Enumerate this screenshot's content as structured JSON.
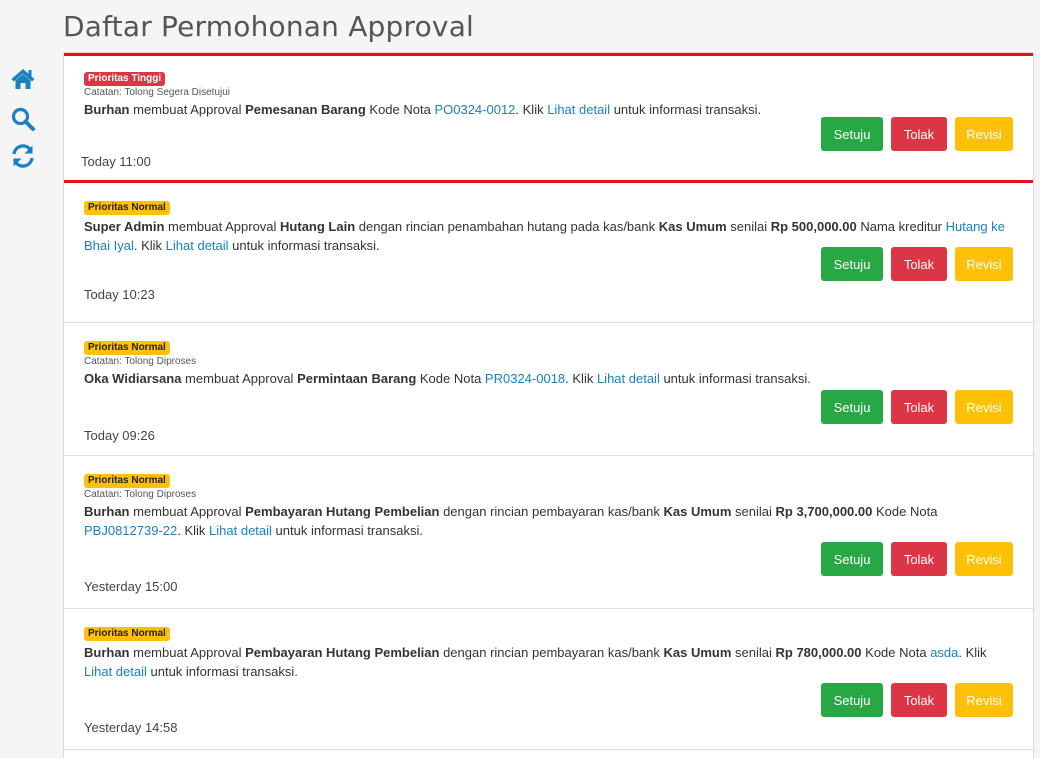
{
  "page": {
    "title": "Daftar Permohonan Approval"
  },
  "sidebar": {
    "icons": [
      "home-icon",
      "search-icon",
      "refresh-icon"
    ]
  },
  "colors": {
    "icon_blue": "#1a80c2",
    "setuju_green": "#28a745",
    "tolak_red": "#dc3545",
    "revisi_yellow": "#ffc107",
    "highlight_border": "#e8101c"
  },
  "buttons": {
    "approve": "Setuju",
    "reject": "Tolak",
    "revise": "Revisi"
  },
  "items": [
    {
      "priority": "Prioritas Tinggi",
      "priority_level": "high",
      "note": "Catatan: Tolong Segera Disetujui",
      "time": "Today 11:00",
      "selected": true,
      "message": [
        {
          "t": "b",
          "v": "Burhan"
        },
        {
          "t": "s",
          "v": " membuat Approval "
        },
        {
          "t": "b",
          "v": "Pemesanan Barang"
        },
        {
          "t": "s",
          "v": " Kode Nota "
        },
        {
          "t": "l",
          "v": "PO0324-0012"
        },
        {
          "t": "s",
          "v": ". Klik "
        },
        {
          "t": "l",
          "v": "Lihat detail"
        },
        {
          "t": "s",
          "v": " untuk informasi transaksi."
        }
      ]
    },
    {
      "priority": "Prioritas Normal",
      "priority_level": "normal",
      "note": "",
      "time": "Today 10:23",
      "selected": false,
      "message": [
        {
          "t": "b",
          "v": "Super Admin"
        },
        {
          "t": "s",
          "v": " membuat Approval "
        },
        {
          "t": "b",
          "v": "Hutang Lain"
        },
        {
          "t": "s",
          "v": " dengan rincian penambahan hutang pada kas/bank "
        },
        {
          "t": "b",
          "v": "Kas Umum"
        },
        {
          "t": "s",
          "v": " senilai "
        },
        {
          "t": "b",
          "v": "Rp 500,000.00"
        },
        {
          "t": "s",
          "v": " Nama kreditur "
        },
        {
          "t": "l",
          "v": "Hutang ke Bhai Iyal"
        },
        {
          "t": "s",
          "v": ". Klik "
        },
        {
          "t": "l",
          "v": "Lihat detail"
        },
        {
          "t": "s",
          "v": " untuk informasi transaksi."
        }
      ]
    },
    {
      "priority": "Prioritas Normal",
      "priority_level": "normal",
      "note": "Catatan: Tolong Diproses",
      "time": "Today 09:26",
      "selected": false,
      "message": [
        {
          "t": "b",
          "v": "Oka Widiarsana"
        },
        {
          "t": "s",
          "v": " membuat Approval "
        },
        {
          "t": "b",
          "v": "Permintaan Barang"
        },
        {
          "t": "s",
          "v": " Kode Nota "
        },
        {
          "t": "l",
          "v": "PR0324-0018"
        },
        {
          "t": "s",
          "v": ". Klik "
        },
        {
          "t": "l",
          "v": "Lihat detail"
        },
        {
          "t": "s",
          "v": " untuk informasi transaksi."
        }
      ]
    },
    {
      "priority": "Prioritas Normal",
      "priority_level": "normal",
      "note": "Catatan: Tolong Diproses",
      "time": "Yesterday 15:00",
      "selected": false,
      "message": [
        {
          "t": "b",
          "v": "Burhan"
        },
        {
          "t": "s",
          "v": " membuat Approval "
        },
        {
          "t": "b",
          "v": "Pembayaran Hutang Pembelian"
        },
        {
          "t": "s",
          "v": " dengan rincian pembayaran kas/bank "
        },
        {
          "t": "b",
          "v": "Kas Umum"
        },
        {
          "t": "s",
          "v": " senilai "
        },
        {
          "t": "b",
          "v": "Rp 3,700,000.00"
        },
        {
          "t": "s",
          "v": " Kode Nota "
        },
        {
          "t": "l",
          "v": "PBJ0812739-22"
        },
        {
          "t": "s",
          "v": ". Klik "
        },
        {
          "t": "l",
          "v": "Lihat detail"
        },
        {
          "t": "s",
          "v": " untuk informasi transaksi."
        }
      ]
    },
    {
      "priority": "Prioritas Normal",
      "priority_level": "normal",
      "note": "",
      "time": "Yesterday 14:58",
      "selected": false,
      "message": [
        {
          "t": "b",
          "v": "Burhan"
        },
        {
          "t": "s",
          "v": " membuat Approval "
        },
        {
          "t": "b",
          "v": "Pembayaran Hutang Pembelian"
        },
        {
          "t": "s",
          "v": " dengan rincian pembayaran kas/bank "
        },
        {
          "t": "b",
          "v": "Kas Umum"
        },
        {
          "t": "s",
          "v": " senilai "
        },
        {
          "t": "b",
          "v": "Rp 780,000.00"
        },
        {
          "t": "s",
          "v": " Kode Nota "
        },
        {
          "t": "l",
          "v": "asda"
        },
        {
          "t": "s",
          "v": ". Klik "
        },
        {
          "t": "l",
          "v": "Lihat detail"
        },
        {
          "t": "s",
          "v": " untuk informasi transaksi."
        }
      ]
    }
  ]
}
